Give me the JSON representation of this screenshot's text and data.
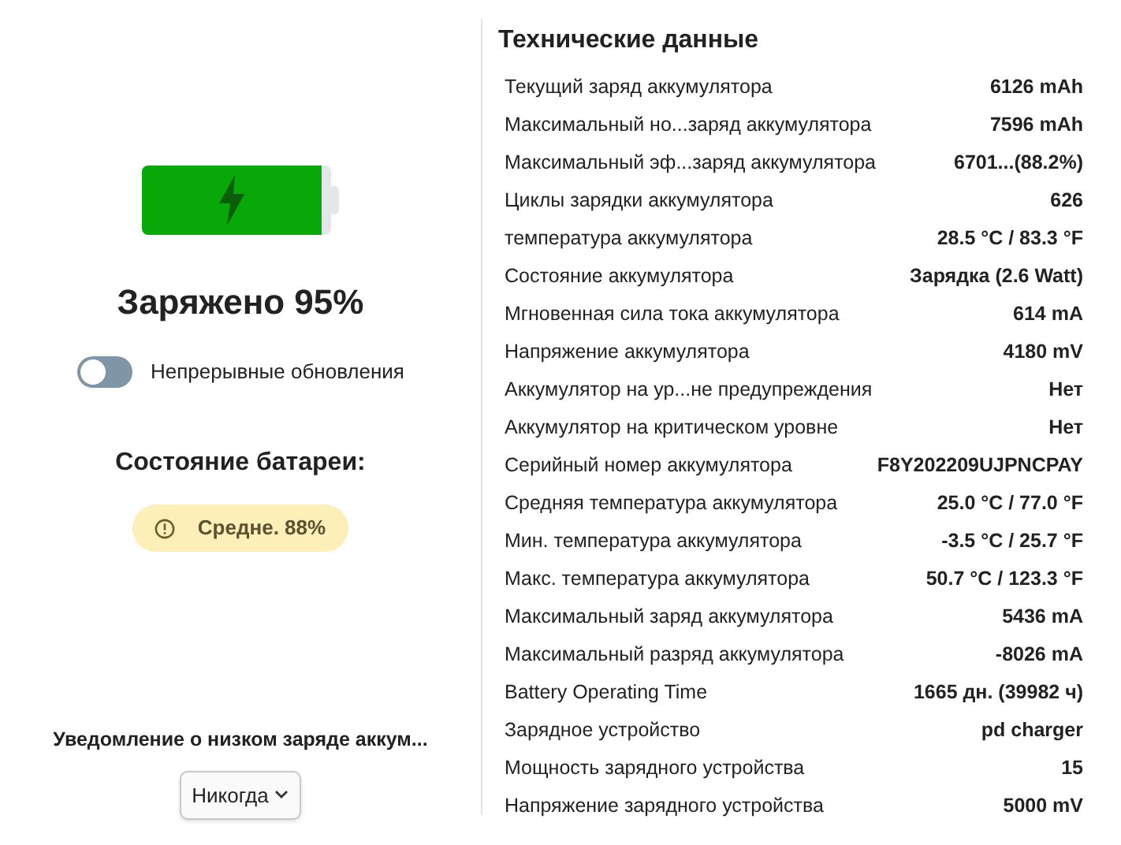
{
  "battery": {
    "level": 0.95,
    "charging": true
  },
  "charge_title": "Заряжено 95%",
  "live_updates": {
    "label": "Непрерывные обновления",
    "on": false
  },
  "health": {
    "title": "Состояние батареи:",
    "badge": "Средне. 88%"
  },
  "low_battery_notice": {
    "label": "Уведомление о низком заряде аккум...",
    "value": "Никогда"
  },
  "specs": {
    "title": "Технические данные",
    "rows": [
      {
        "label": "Текущий заряд аккумулятора",
        "value": "6126 mAh"
      },
      {
        "label": "Максимальный но...заряд аккумулятора",
        "value": "7596 mAh"
      },
      {
        "label": "Максимальный эф...заряд аккумулятора",
        "value": "6701...(88.2%)"
      },
      {
        "label": "Циклы зарядки аккумулятора",
        "value": "626"
      },
      {
        "label": "температура аккумулятора",
        "value": "28.5 °C / 83.3 °F"
      },
      {
        "label": "Состояние аккумулятора",
        "value": "Зарядка (2.6 Watt)"
      },
      {
        "label": "Мгновенная сила тока аккумулятора",
        "value": "614 mA"
      },
      {
        "label": "Напряжение аккумулятора",
        "value": "4180 mV"
      },
      {
        "label": "Аккумулятор на ур...не предупреждения",
        "value": "Нет"
      },
      {
        "label": "Аккумулятор на критическом уровне",
        "value": "Нет"
      },
      {
        "label": "Серийный номер аккумулятора",
        "value": "F8Y202209UJPNCPAY"
      },
      {
        "label": "Средняя температура аккумулятора",
        "value": "25.0 °C / 77.0 °F"
      },
      {
        "label": "Мин. температура аккумулятора",
        "value": "-3.5 °C / 25.7 °F"
      },
      {
        "label": "Макс. температура аккумулятора",
        "value": "50.7 °C / 123.3 °F"
      },
      {
        "label": "Максимальный заряд аккумулятора",
        "value": "5436 mA"
      },
      {
        "label": "Максимальный разряд аккумулятора",
        "value": "-8026 mA"
      },
      {
        "label": "Battery Operating Time",
        "value": "1665 дн. (39982 ч)"
      },
      {
        "label": "Зарядное устройство",
        "value": "pd charger"
      },
      {
        "label": "Мощность зарядного устройства",
        "value": "15"
      },
      {
        "label": "Напряжение зарядного устройства",
        "value": "5000 mV"
      }
    ]
  }
}
